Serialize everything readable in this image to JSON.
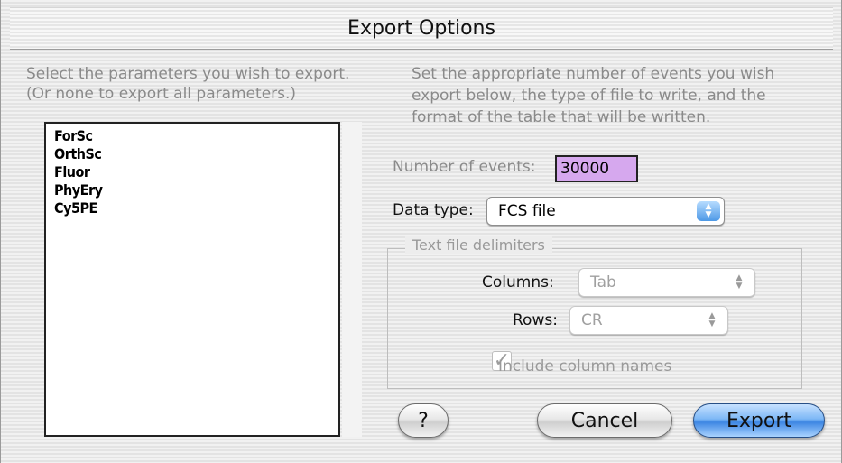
{
  "window": {
    "title": "Export Options"
  },
  "left_panel": {
    "instruction_line1": "Select the parameters you wish to export.",
    "instruction_line2": "(Or none to export all parameters.)",
    "parameters": [
      "ForSc",
      "OrthSc",
      "Fluor",
      "PhyEry",
      "Cy5PE"
    ]
  },
  "right_panel": {
    "instruction_line1": "Set the appropriate number of events you wish",
    "instruction_line2": "export below, the type of file to write, and the",
    "instruction_line3": "format of the table that will be written.",
    "events_label": "Number of events:",
    "events_value": "30000",
    "data_type_label": "Data type:",
    "data_type_value": "FCS file",
    "delimiters_group": {
      "title": "Text file delimiters",
      "columns_label": "Columns:",
      "columns_value": "Tab",
      "rows_label": "Rows:",
      "rows_value": "CR",
      "include_names_label": "Include column names",
      "include_names_checked": true
    }
  },
  "buttons": {
    "help": "?",
    "cancel": "Cancel",
    "export": "Export"
  },
  "colors": {
    "events_field_bg": "#d6a8ee",
    "primary_button": "#4d98e6"
  }
}
